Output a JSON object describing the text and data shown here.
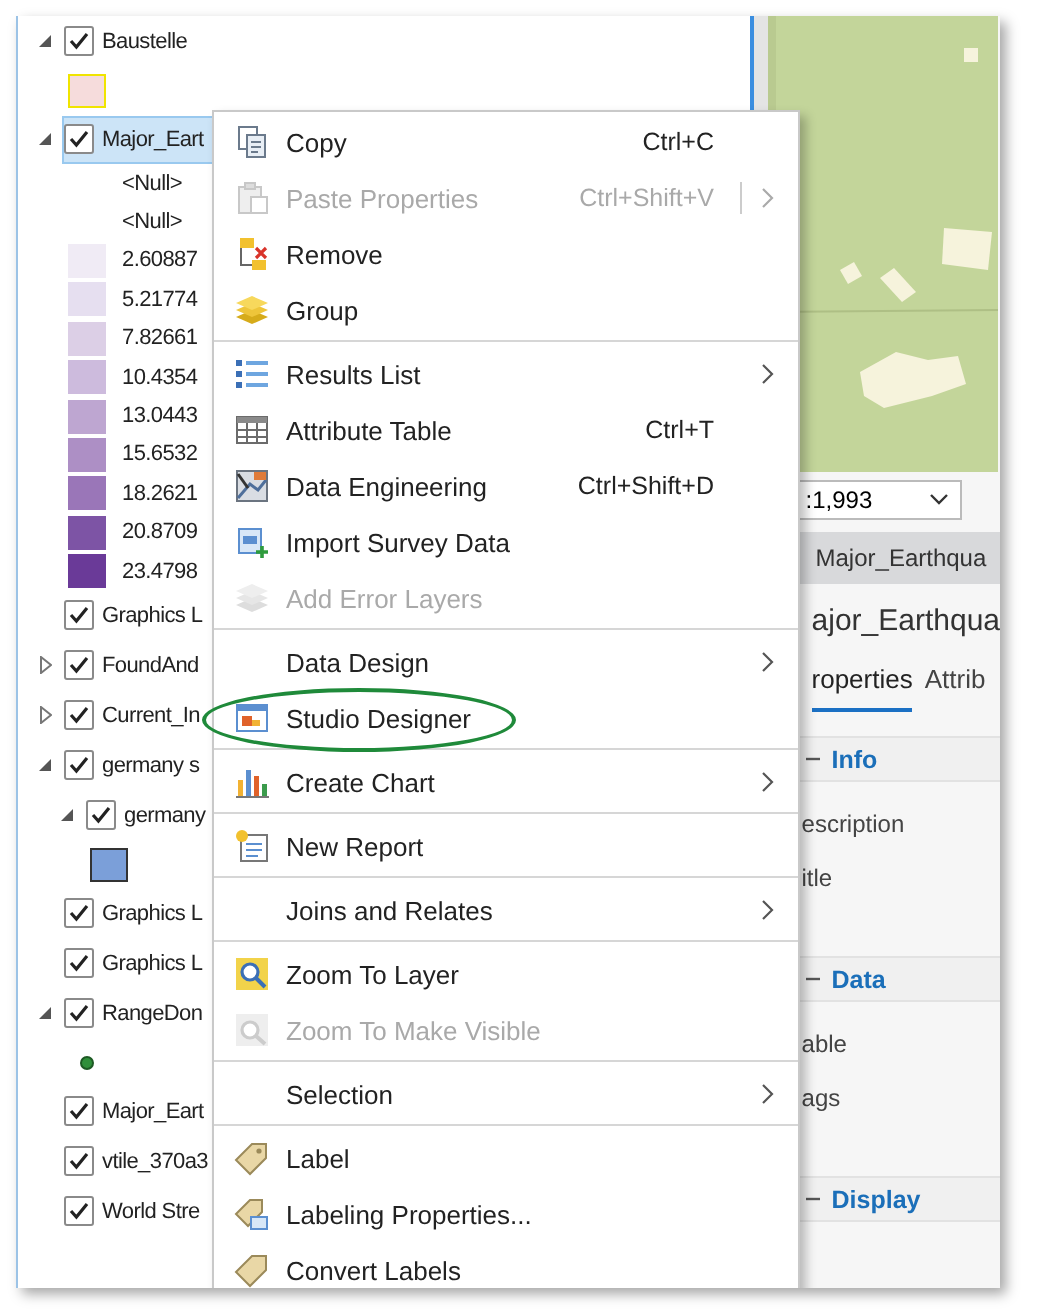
{
  "contents": {
    "layers": [
      {
        "name": "Baustelle",
        "kind": "expandable",
        "expanded": true,
        "checked": true,
        "selected": false,
        "legend": [
          {
            "kind": "outlined",
            "color": "#f6dcdc"
          }
        ]
      },
      {
        "name": "Major_Eart",
        "kind": "expandable",
        "expanded": true,
        "checked": true,
        "selected": true,
        "legend": [
          {
            "kind": "blank",
            "label": "<Null>"
          },
          {
            "kind": "blank",
            "label": "<Null>"
          },
          {
            "kind": "fill",
            "label": "2.60887",
            "color": "#f0ebf5"
          },
          {
            "kind": "fill",
            "label": "5.21774",
            "color": "#e6dff0"
          },
          {
            "kind": "fill",
            "label": "7.82661",
            "color": "#dccfe6"
          },
          {
            "kind": "fill",
            "label": "10.4354",
            "color": "#cdbbdd"
          },
          {
            "kind": "fill",
            "label": "13.0443",
            "color": "#bea6d1"
          },
          {
            "kind": "fill",
            "label": "15.6532",
            "color": "#ad8fc5"
          },
          {
            "kind": "fill",
            "label": "18.2621",
            "color": "#9a76b8"
          },
          {
            "kind": "fill",
            "label": "20.8709",
            "color": "#7d54a5"
          },
          {
            "kind": "fill",
            "label": "23.4798",
            "color": "#6a3a98"
          }
        ]
      },
      {
        "name": "Graphics L",
        "kind": "plain",
        "checked": true,
        "selected": false
      },
      {
        "name": "FoundAnd",
        "kind": "expandable",
        "expanded": false,
        "checked": true,
        "selected": false
      },
      {
        "name": "Current_In",
        "kind": "expandable",
        "expanded": false,
        "checked": true,
        "selected": false
      },
      {
        "name": "germany s",
        "kind": "expandable",
        "expanded": true,
        "checked": true,
        "selected": false,
        "children": [
          {
            "name": "germany",
            "kind": "expandable",
            "expanded": true,
            "checked": true,
            "selected": false,
            "legend": [
              {
                "kind": "framed",
                "color": "#7b9fd9"
              }
            ]
          }
        ]
      },
      {
        "name": "Graphics L",
        "kind": "plain",
        "checked": true,
        "selected": false
      },
      {
        "name": "Graphics L",
        "kind": "plain",
        "checked": true,
        "selected": false
      },
      {
        "name": "RangeDon",
        "kind": "expandable",
        "expanded": true,
        "checked": true,
        "selected": false,
        "legend": [
          {
            "kind": "point",
            "color": "#2f8f3a"
          }
        ]
      },
      {
        "name": "Major_Eart",
        "kind": "plain",
        "checked": true,
        "selected": false
      },
      {
        "name": "vtile_370a3",
        "kind": "plain",
        "checked": true,
        "selected": false
      },
      {
        "name": "World Stre",
        "kind": "plain",
        "checked": true,
        "selected": false
      }
    ]
  },
  "scale": ":1,993",
  "view_tab": "Major_Earthqua",
  "pane": {
    "title": "ajor_Earthqua",
    "tabs": [
      {
        "label": "roperties",
        "selected": true
      },
      {
        "label": "Attrib",
        "selected": false
      }
    ],
    "sections": [
      {
        "title": "Info",
        "expanded": true,
        "fields": [
          "escription",
          "itle"
        ]
      },
      {
        "title": "Data",
        "expanded": true,
        "fields": [
          "able",
          "ags"
        ]
      },
      {
        "title": "Display",
        "expanded": true
      }
    ]
  },
  "menu": {
    "items": [
      {
        "kind": "item",
        "label": "Copy",
        "shortcut": "Ctrl+C",
        "disabled": false,
        "submenu": false,
        "circled": false
      },
      {
        "kind": "item",
        "label": "Paste Properties",
        "shortcut": "Ctrl+Shift+V",
        "disabled": true,
        "submenu": true,
        "circled": false
      },
      {
        "kind": "item",
        "label": "Remove",
        "disabled": false,
        "submenu": false,
        "circled": false
      },
      {
        "kind": "item",
        "label": "Group",
        "disabled": false,
        "submenu": false,
        "circled": false
      },
      {
        "kind": "separator"
      },
      {
        "kind": "item",
        "label": "Results List",
        "disabled": false,
        "submenu": true,
        "circled": false
      },
      {
        "kind": "item",
        "label": "Attribute Table",
        "shortcut": "Ctrl+T",
        "disabled": false,
        "submenu": false,
        "circled": false
      },
      {
        "kind": "item",
        "label": "Data Engineering",
        "shortcut": "Ctrl+Shift+D",
        "disabled": false,
        "submenu": false,
        "circled": false
      },
      {
        "kind": "item",
        "label": "Import Survey Data",
        "disabled": false,
        "submenu": false,
        "circled": false
      },
      {
        "kind": "item",
        "label": "Add Error Layers",
        "disabled": true,
        "submenu": false,
        "circled": false
      },
      {
        "kind": "separator"
      },
      {
        "kind": "item",
        "label": "Data Design",
        "disabled": false,
        "submenu": true,
        "circled": false
      },
      {
        "kind": "item",
        "label": "Studio Designer",
        "disabled": false,
        "submenu": false,
        "circled": true
      },
      {
        "kind": "separator"
      },
      {
        "kind": "item",
        "label": "Create Chart",
        "disabled": false,
        "submenu": true,
        "circled": false
      },
      {
        "kind": "separator"
      },
      {
        "kind": "item",
        "label": "New Report",
        "disabled": false,
        "submenu": false,
        "circled": false
      },
      {
        "kind": "separator"
      },
      {
        "kind": "item",
        "label": "Joins and Relates",
        "disabled": false,
        "submenu": true,
        "circled": false
      },
      {
        "kind": "separator"
      },
      {
        "kind": "item",
        "label": "Zoom To Layer",
        "disabled": false,
        "submenu": false,
        "circled": false
      },
      {
        "kind": "item",
        "label": "Zoom To Make Visible",
        "disabled": true,
        "submenu": false,
        "circled": false
      },
      {
        "kind": "separator"
      },
      {
        "kind": "item",
        "label": "Selection",
        "disabled": false,
        "submenu": true,
        "circled": false
      },
      {
        "kind": "separator"
      },
      {
        "kind": "item",
        "label": "Label",
        "disabled": false,
        "submenu": false,
        "circled": false
      },
      {
        "kind": "item",
        "label": "Labeling Properties...",
        "disabled": false,
        "submenu": false,
        "circled": false
      },
      {
        "kind": "item",
        "label": "Convert Labels",
        "disabled": false,
        "submenu": false,
        "circled": false
      }
    ]
  }
}
